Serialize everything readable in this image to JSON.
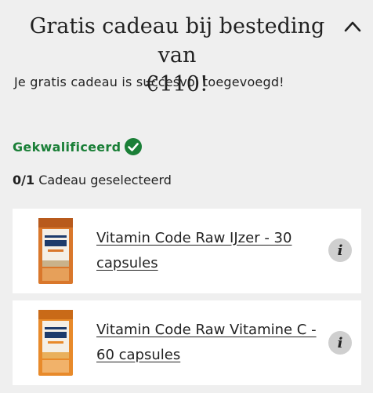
{
  "header": {
    "title_line1": "Gratis cadeau bij besteding van",
    "title_line2": "€110!",
    "collapse_icon": "chevron-up-icon"
  },
  "subtitle": "Je gratis cadeau is succesvol toegevoegd!",
  "status": {
    "label": "Gekwalificeerd",
    "icon": "check-circle-icon",
    "color": "#1a7f37"
  },
  "selection": {
    "count": "0/1",
    "label": "Cadeau geselecteerd"
  },
  "products": [
    {
      "name": "Vitamin Code Raw IJzer - 30 capsules",
      "image_icon": "product-bottle-icon",
      "info_icon": "info-icon",
      "info_glyph": "i"
    },
    {
      "name": "Vitamin Code Raw Vitamine C - 60 capsules",
      "image_icon": "product-bottle-icon",
      "info_icon": "info-icon",
      "info_glyph": "i"
    }
  ]
}
